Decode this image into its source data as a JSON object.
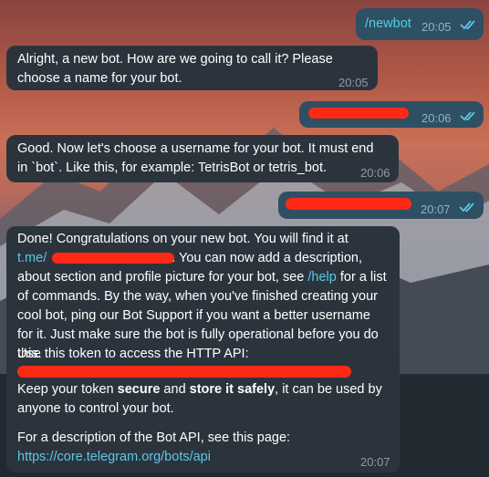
{
  "messages": {
    "m1": {
      "text": "/newbot",
      "time": "20:05",
      "status": "read"
    },
    "m2": {
      "text": "Alright, a new bot. How are we going to call it? Please choose a name for your bot.",
      "time": "20:05"
    },
    "m3": {
      "time": "20:06",
      "status": "read"
    },
    "m4": {
      "text": "Good. Now let's choose a username for your bot. It must end in `bot`. Like this, for example: TetrisBot or tetris_bot.",
      "time": "20:06"
    },
    "m5": {
      "time": "20:07",
      "status": "read"
    },
    "m6": {
      "p1_a": "Done! Congratulations on your new bot. You will find it at",
      "p1_link": "t.me/",
      "p1_b": ". You can now add a description, about section and profile picture for your bot, see ",
      "p1_help": "/help",
      "p1_c": " for a list of commands. By the way, when you've finished creating your cool bot, ping our Bot Support if you want a better username for it. Just make sure the bot is fully operational before you do this.",
      "p2": "Use this token to access the HTTP API:",
      "p3_a": "Keep your token ",
      "p3_secure": "secure",
      "p3_b": " and ",
      "p3_store": "store it safely",
      "p3_c": ", it can be used by anyone to control your bot.",
      "p4": "For a description of the Bot API, see this page:",
      "p4_link": "https://core.telegram.org/bots/api",
      "time": "20:07"
    }
  },
  "colors": {
    "incoming_bubble": "#2b343d",
    "outgoing_bubble": "#2f4f62",
    "accent": "#4fd0df",
    "link": "#5ec6ea",
    "redaction": "#ff2a16"
  },
  "icons": {
    "read_receipt": "double-check-icon"
  }
}
